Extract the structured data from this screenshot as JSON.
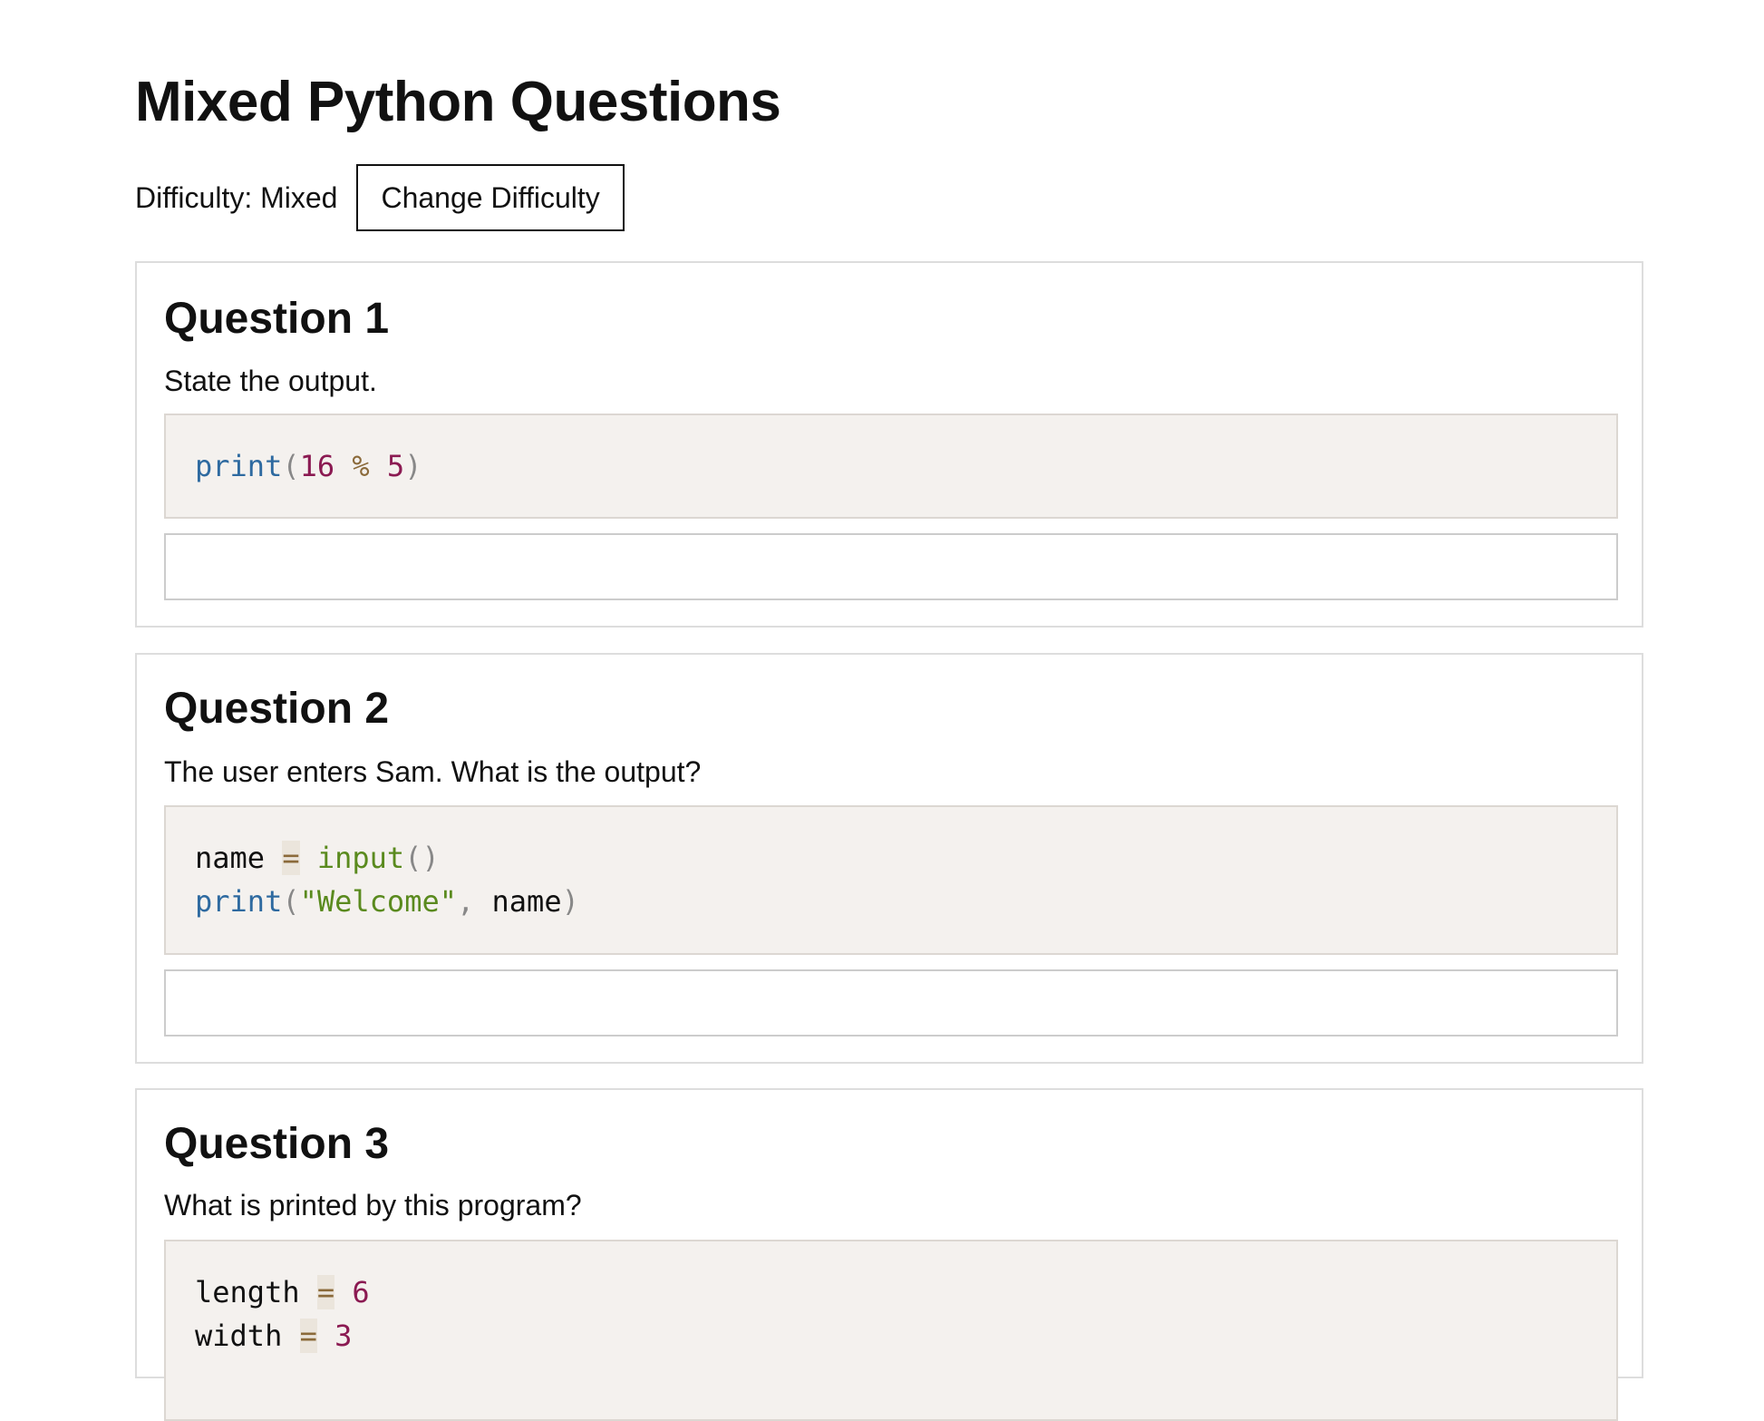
{
  "page": {
    "title": "Mixed Python Questions",
    "difficulty_label": "Difficulty: Mixed",
    "change_difficulty_label": "Change Difficulty"
  },
  "questions": [
    {
      "heading": "Question 1",
      "prompt": "State the output.",
      "code_lines": [
        [
          {
            "t": "print",
            "c": "kw"
          },
          {
            "t": "(",
            "c": "pun"
          },
          {
            "t": "16",
            "c": "num"
          },
          {
            "t": " ",
            "c": "var"
          },
          {
            "t": "%",
            "c": "op"
          },
          {
            "t": " ",
            "c": "var"
          },
          {
            "t": "5",
            "c": "num"
          },
          {
            "t": ")",
            "c": "pun"
          }
        ]
      ],
      "answer_value": ""
    },
    {
      "heading": "Question 2",
      "prompt": "The user enters Sam. What is the output?",
      "code_lines": [
        [
          {
            "t": "name",
            "c": "var"
          },
          {
            "t": " ",
            "c": "var"
          },
          {
            "t": "=",
            "c": "op hl"
          },
          {
            "t": " ",
            "c": "var"
          },
          {
            "t": "input",
            "c": "fn"
          },
          {
            "t": "()",
            "c": "pun"
          }
        ],
        [
          {
            "t": "print",
            "c": "kw"
          },
          {
            "t": "(",
            "c": "pun"
          },
          {
            "t": "\"Welcome\"",
            "c": "str"
          },
          {
            "t": ", ",
            "c": "pun"
          },
          {
            "t": "name",
            "c": "var"
          },
          {
            "t": ")",
            "c": "pun"
          }
        ]
      ],
      "answer_value": ""
    },
    {
      "heading": "Question 3",
      "prompt": "What is printed by this program?",
      "code_lines": [
        [
          {
            "t": "length",
            "c": "var"
          },
          {
            "t": " ",
            "c": "var"
          },
          {
            "t": "=",
            "c": "op hl"
          },
          {
            "t": " ",
            "c": "var"
          },
          {
            "t": "6",
            "c": "num"
          }
        ],
        [
          {
            "t": "width",
            "c": "var"
          },
          {
            "t": " ",
            "c": "var"
          },
          {
            "t": "=",
            "c": "op hl"
          },
          {
            "t": " ",
            "c": "var"
          },
          {
            "t": "3",
            "c": "num"
          }
        ]
      ],
      "answer_value": ""
    }
  ]
}
